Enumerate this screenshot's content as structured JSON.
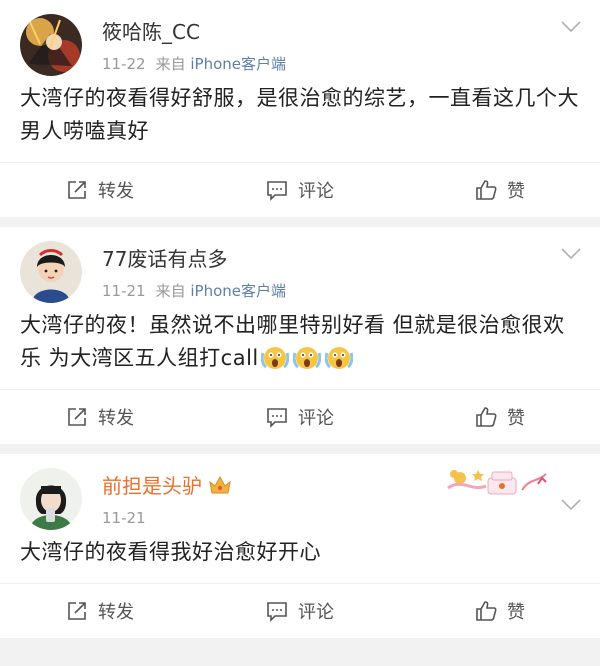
{
  "posts": [
    {
      "username": "筱哈陈_CC",
      "date": "11-22",
      "from_label": "来自",
      "source_app": "iPhone客户端",
      "text": "大湾仔的夜看得好舒服，是很治愈的综艺，一直看这几个大男人唠嗑真好",
      "actions": {
        "repost": "转发",
        "comment": "评论",
        "like": "赞"
      }
    },
    {
      "username": "77废话有点多",
      "date": "11-21",
      "from_label": "来自",
      "source_app": "iPhone客户端",
      "text": "大湾仔的夜！虽然说不出哪里特别好看 但就是很治愈很欢乐 为大湾区五人组打call",
      "actions": {
        "repost": "转发",
        "comment": "评论",
        "like": "赞"
      }
    },
    {
      "username": "前担是头驴",
      "date": "11-21",
      "text": "大湾仔的夜看得我好治愈好开心",
      "actions": {
        "repost": "转发",
        "comment": "评论",
        "like": "赞"
      }
    }
  ],
  "colors": {
    "background": "#f2f2f2",
    "card": "#ffffff",
    "source_link": "#5f7fa8",
    "vip_name": "#e8702a",
    "meta": "#999999"
  },
  "icons": [
    "chevron-down-icon",
    "repost-icon",
    "comment-icon",
    "like-icon",
    "scream-emoji",
    "vip-crown-icon",
    "birthday-cake-badge"
  ]
}
